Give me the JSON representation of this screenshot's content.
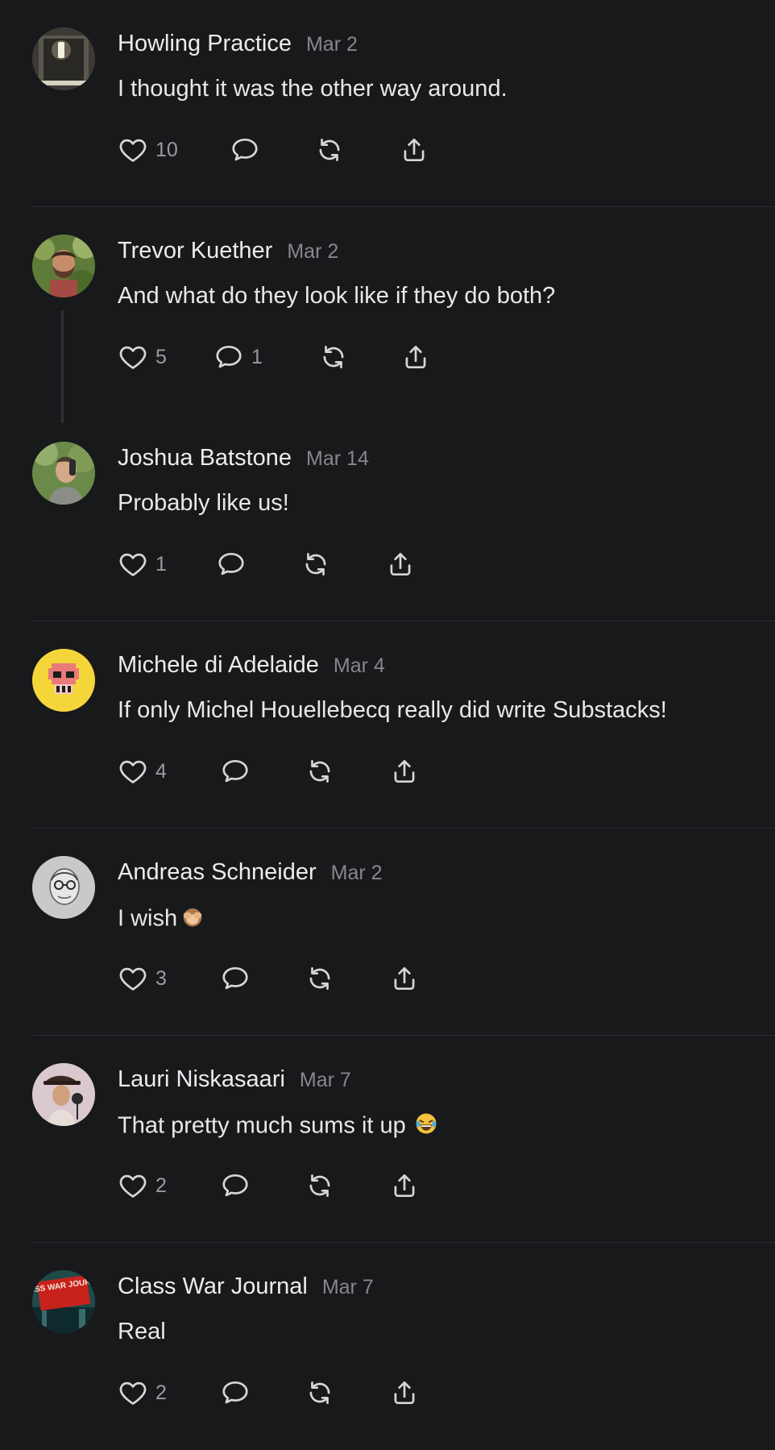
{
  "comments": [
    {
      "author": "Howling Practice",
      "date": "Mar 2",
      "text": "I thought it was the other way around.",
      "likes": "10",
      "replies": "",
      "avatar_icon": "lamp-photo-avatar"
    },
    {
      "author": "Trevor Kuether",
      "date": "Mar 2",
      "text": "And what do they look like if they do both?",
      "likes": "5",
      "replies": "1",
      "avatar_icon": "bearded-man-avatar"
    },
    {
      "author": "Joshua Batstone",
      "date": "Mar 14",
      "text": "Probably like us!",
      "likes": "1",
      "replies": "",
      "avatar_icon": "man-outdoors-avatar"
    },
    {
      "author": "Michele di Adelaide",
      "date": "Mar 4",
      "text": "If only Michel Houellebecq really did write Substacks!",
      "likes": "4",
      "replies": "",
      "avatar_icon": "pixel-skull-avatar"
    },
    {
      "author": "Andreas Schneider",
      "date": "Mar 2",
      "text": "I wish",
      "likes": "3",
      "replies": "",
      "avatar_icon": "man-glasses-sketch-avatar",
      "emoji": "see-no-evil-monkey-emoji"
    },
    {
      "author": "Lauri Niskasaari",
      "date": "Mar 7",
      "text": "That pretty much sums it up",
      "likes": "2",
      "replies": "",
      "avatar_icon": "man-hat-microphone-avatar",
      "emoji": "tears-of-joy-emoji"
    },
    {
      "author": "Class War Journal",
      "date": "Mar 7",
      "text": "Real",
      "likes": "2",
      "replies": "",
      "avatar_icon": "class-war-journal-logo-avatar",
      "avatar_text": "CLASS WAR JOURNAL"
    }
  ],
  "colors": {
    "background": "#18191b",
    "text": "#e8e8ea",
    "muted": "#86878b",
    "icon": "#d6d6d8",
    "divider": "#2c2d30",
    "emoji_yellow": "#f5c33b"
  }
}
